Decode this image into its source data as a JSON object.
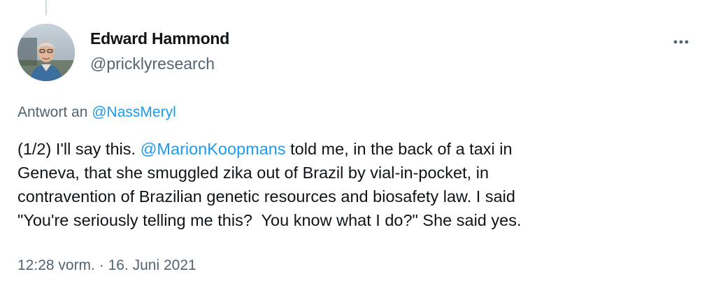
{
  "tweet": {
    "author_name": "Edward Hammond",
    "author_handle": "@pricklyresearch",
    "reply_prefix": "Antwort an",
    "reply_to_handle": "@NassMeryl",
    "text_part1": "(1/2) I'll say this. ",
    "text_mention": "@MarionKoopmans",
    "text_part2": " told me, in the back of a taxi in\nGeneva, that she smuggled zika out of Brazil by vial-in-pocket, in\ncontravention of Brazilian genetic resources and biosafety law. I said\n\"You're seriously telling me this?  You know what I do?\" She said yes.",
    "time": "12:28 vorm.",
    "separator": "·",
    "date": "16. Juni 2021"
  },
  "icons": {
    "more": "more-horizontal-icon",
    "avatar": "profile-photo"
  },
  "colors": {
    "text_primary": "#0f1419",
    "text_secondary": "#536471",
    "link": "#1d9bf0",
    "thread_line": "#cfd9de"
  }
}
